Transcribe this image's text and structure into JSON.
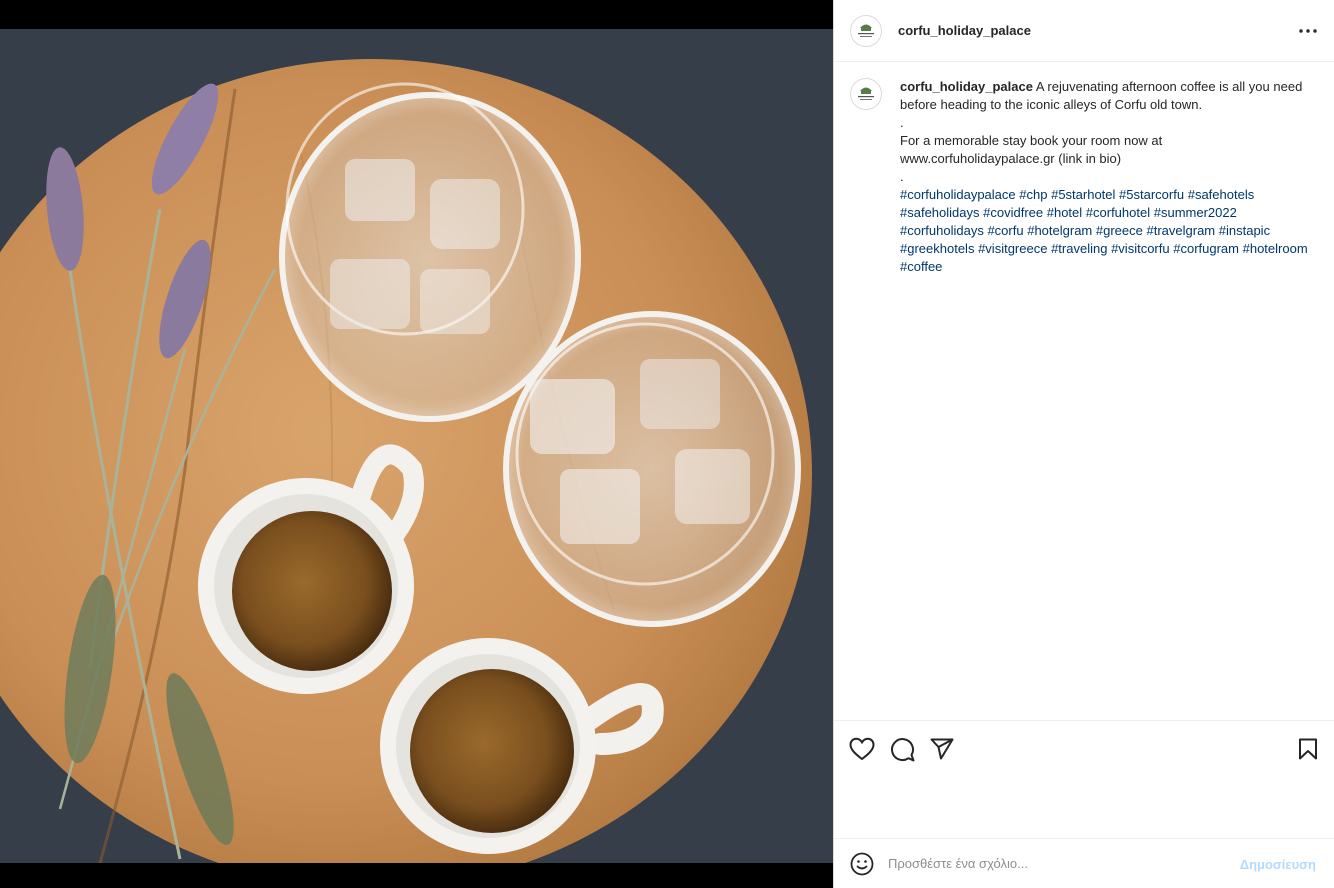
{
  "post": {
    "username": "corfu_holiday_palace",
    "avatar_text": "CORFU HOLIDAY PALACE",
    "caption": {
      "username": "corfu_holiday_palace",
      "text_line1": " A rejuvenating afternoon coffee is all you need before heading to the iconic alleys of Corfu old town.",
      "dot1": ".",
      "text_line2": "For a memorable stay book your room now at www.corfuholidaypalace.gr (link in bio)",
      "dot2": ".",
      "hashtags": [
        "#corfuholidaypalace",
        "#chp",
        "#5starhotel",
        "#5starcorfu",
        "#safehotels",
        "#safeholidays",
        "#covidfree",
        "#hotel",
        "#corfuhotel",
        "#summer2022",
        "#corfuholidays",
        "#corfu",
        "#hotelgram",
        "#greece",
        "#travelgram",
        "#instapic",
        "#greekhotels",
        "#visitgreece",
        "#traveling",
        "#visitcorfu",
        "#corfugram",
        "#hotelroom",
        "#coffee"
      ]
    },
    "actions": {
      "like_icon": "heart-icon",
      "comment_icon": "comment-bubble-icon",
      "share_icon": "paper-plane-icon",
      "save_icon": "bookmark-icon",
      "more_icon": "more-dots-icon"
    },
    "comment": {
      "placeholder": "Προσθέστε ένα σχόλιο...",
      "post_label": "Δημοσίευση",
      "emoji_icon": "emoji-icon"
    }
  },
  "colors": {
    "text": "#262626",
    "hashtag": "#00376b",
    "post_button_disabled": "#b3dbff",
    "border": "#dbdbdb"
  }
}
